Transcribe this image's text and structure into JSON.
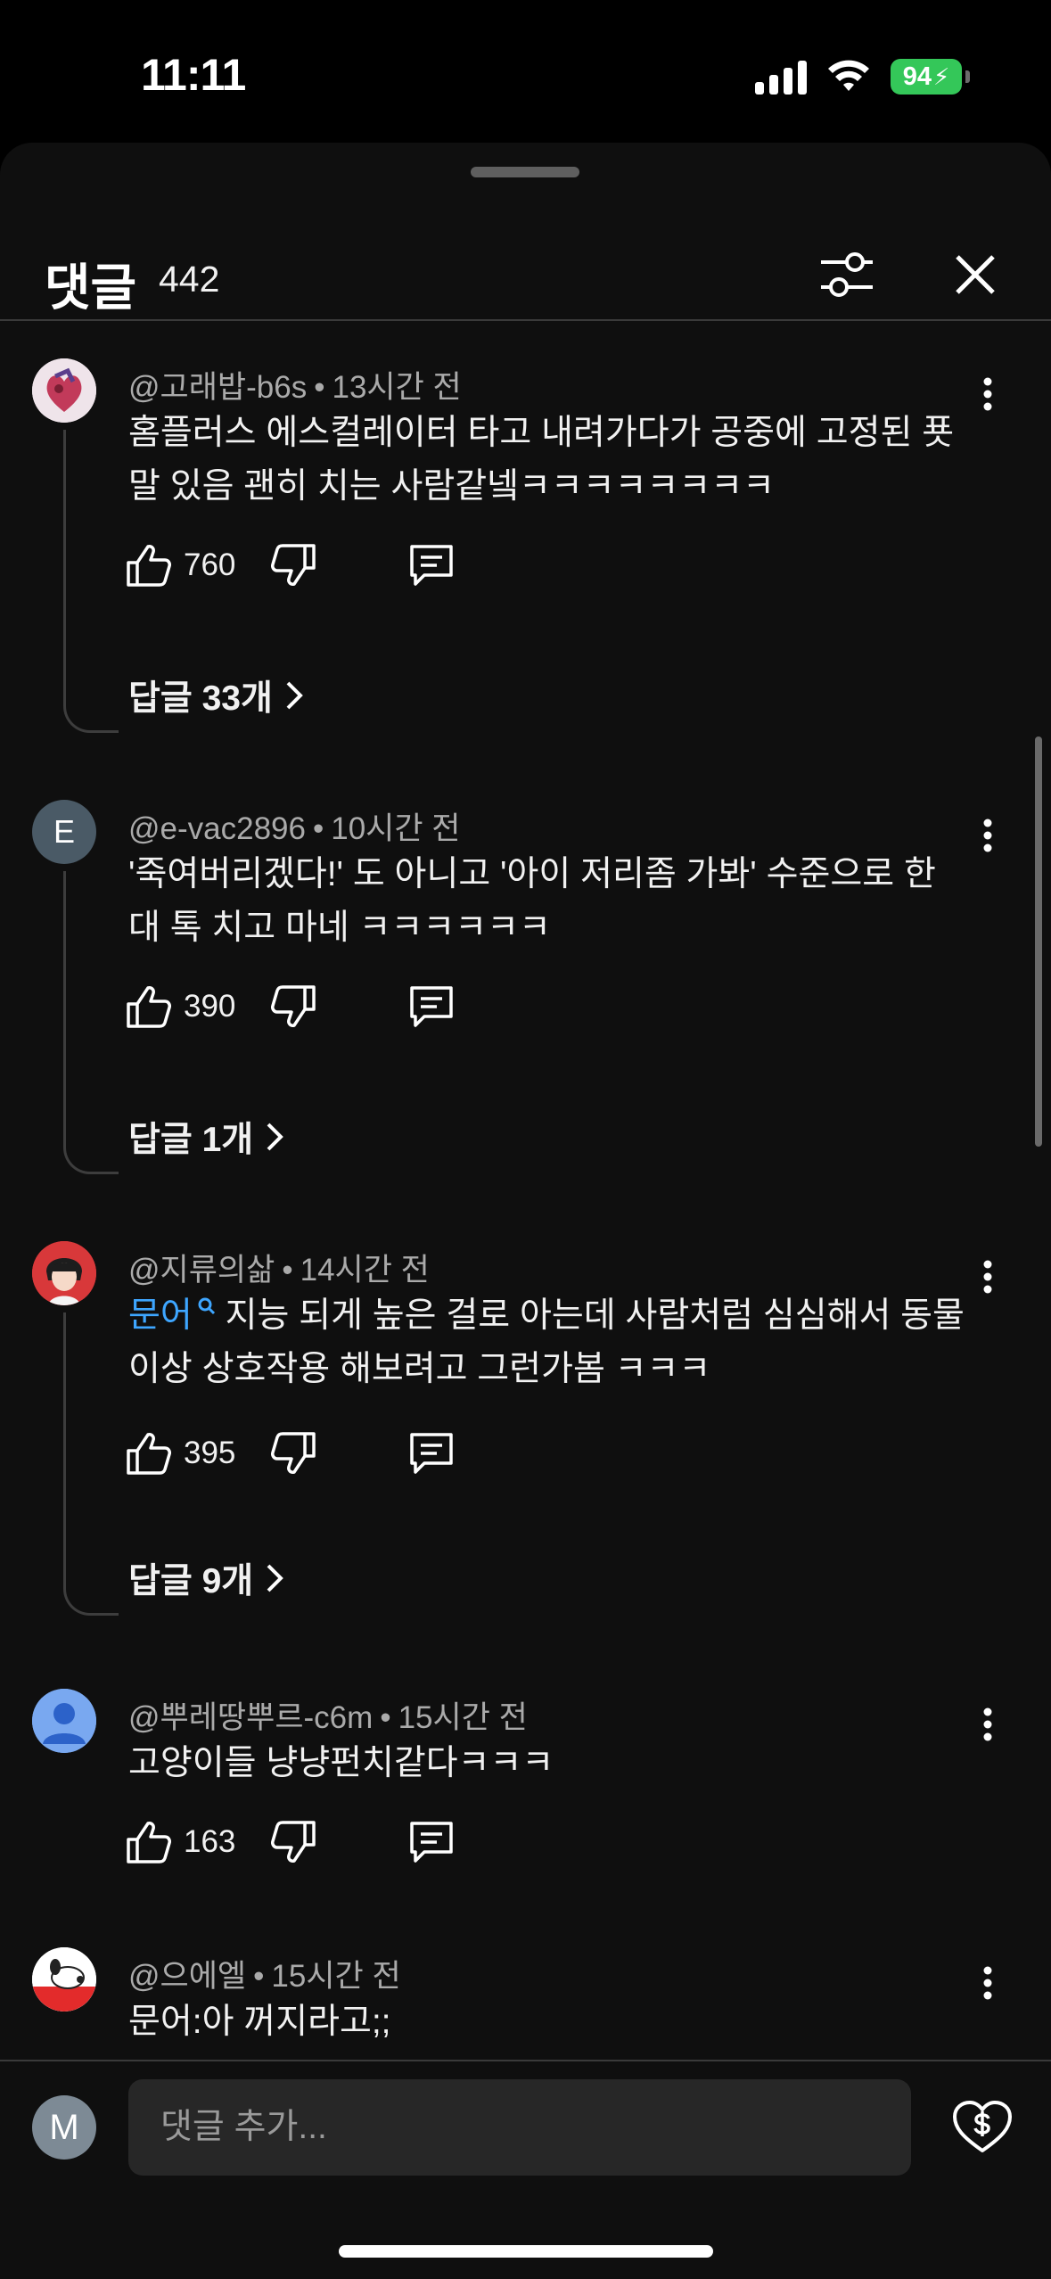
{
  "status_bar": {
    "time": "11:11",
    "battery": "94"
  },
  "header": {
    "title": "댓글",
    "count": "442"
  },
  "comments": [
    {
      "author": "@고래밥-b6s",
      "time": "13시간 전",
      "text": "홈플러스 에스컬레이터 타고 내려가다가 공중에 고정된 푯말 있음 괜히 치는 사람같넼ㅋㅋㅋㅋㅋㅋㅋㅋ",
      "likes": "760",
      "replies": "답글 33개"
    },
    {
      "author": "@e-vac2896",
      "time": "10시간 전",
      "avatar_letter": "E",
      "text": "'죽여버리겠다!' 도 아니고 '아이 저리좀 가봐' 수준으로 한 대 톡 치고 마네 ㅋㅋㅋㅋㅋㅋ",
      "likes": "390",
      "replies": "답글 1개"
    },
    {
      "author": "@지류의삶",
      "time": "14시간 전",
      "link_text": "문어",
      "text": " 지능 되게 높은 걸로 아는데 사람처럼 심심해서 동물이상 상호작용 해보려고 그런가봄 ㅋㅋㅋ",
      "likes": "395",
      "replies": "답글 9개"
    },
    {
      "author": "@뿌레땅뿌르-c6m",
      "time": "15시간 전",
      "text": "고양이들 냥냥펀치같다ㅋㅋㅋ",
      "likes": "163"
    },
    {
      "author": "@으에엘",
      "time": "15시간 전",
      "text": "문어:아 꺼지라고;;"
    }
  ],
  "input": {
    "avatar_letter": "M",
    "placeholder": "댓글 추가..."
  },
  "colors": {
    "background": "#0f0f0f",
    "link": "#3ea6ff",
    "muted": "#aaaaaa",
    "battery": "#34c759"
  },
  "icons": [
    "filter-icon",
    "close-icon",
    "more-vert-icon",
    "thumb-up-icon",
    "thumb-down-icon",
    "reply-icon",
    "chevron-right-icon",
    "super-thanks-icon"
  ]
}
